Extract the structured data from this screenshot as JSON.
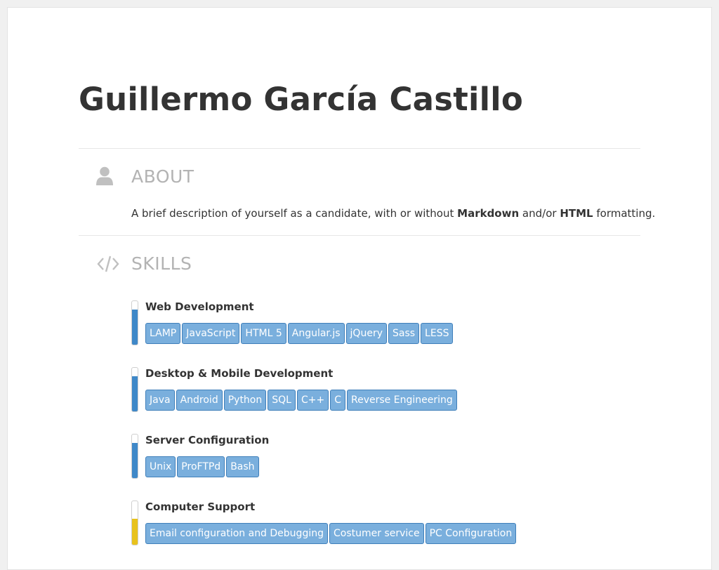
{
  "name": "Guillermo García Castillo",
  "about": {
    "title": "ABOUT",
    "icon": "user-icon",
    "text_before": "A brief description of yourself as a candidate, with or without ",
    "bold1": "Markdown",
    "text_mid": " and/or ",
    "bold2": "HTML",
    "text_after": " formatting."
  },
  "skills": {
    "title": "SKILLS",
    "icon": "code-icon",
    "items": [
      {
        "name": "Web Development",
        "level": 0.8,
        "color": "#3f88c8",
        "tags": [
          "LAMP",
          "JavaScript",
          "HTML 5",
          "Angular.js",
          "jQuery",
          "Sass",
          "LESS"
        ]
      },
      {
        "name": "Desktop & Mobile Development",
        "level": 0.8,
        "color": "#3f88c8",
        "tags": [
          "Java",
          "Android",
          "Python",
          "SQL",
          "C++",
          "C",
          "Reverse Engineering"
        ]
      },
      {
        "name": "Server Configuration",
        "level": 0.8,
        "color": "#3f88c8",
        "tags": [
          "Unix",
          "ProFTPd",
          "Bash"
        ]
      },
      {
        "name": "Computer Support",
        "level": 0.6,
        "color": "#e8c21c",
        "tags": [
          "Email configuration and Debugging",
          "Costumer service",
          "PC Configuration"
        ]
      }
    ]
  },
  "colors": {
    "tag_bg": "#7aafdd",
    "tag_border": "#3f7fba",
    "section_title": "#b3b3b3"
  }
}
